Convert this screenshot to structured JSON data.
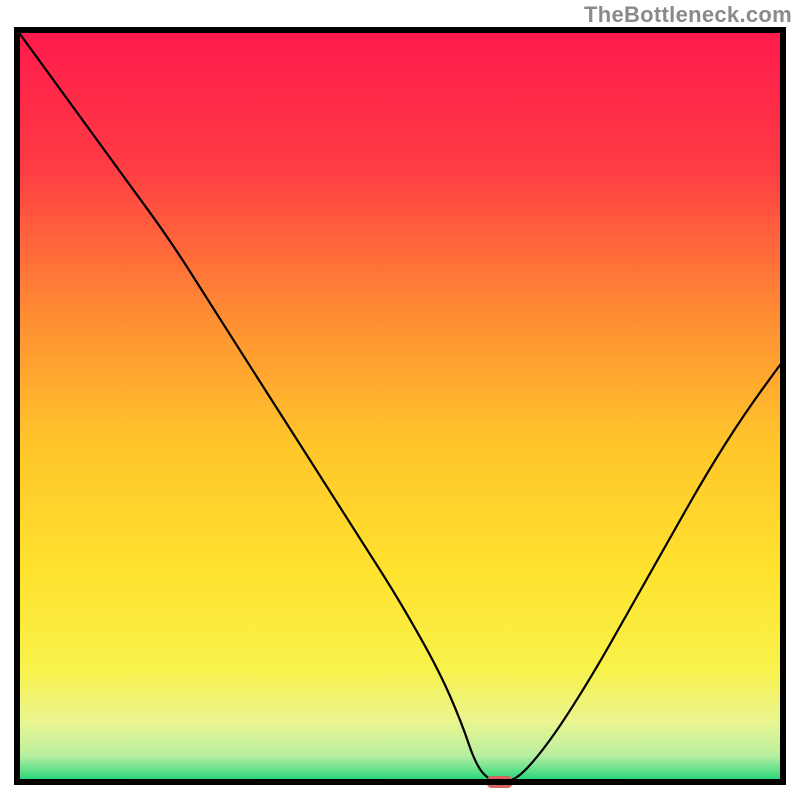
{
  "watermark": "TheBottleneck.com",
  "chart_data": {
    "type": "line",
    "title": "",
    "xlabel": "",
    "ylabel": "",
    "xlim": [
      0,
      100
    ],
    "ylim": [
      0,
      100
    ],
    "x": [
      0,
      5,
      10,
      15,
      20,
      25,
      30,
      35,
      40,
      45,
      50,
      55,
      58,
      60,
      62,
      64,
      66,
      70,
      75,
      80,
      85,
      90,
      95,
      100
    ],
    "values": [
      100,
      93,
      86,
      79,
      72,
      64,
      56,
      48,
      40,
      32,
      24,
      15,
      8,
      2,
      0,
      0,
      1,
      6,
      14,
      23,
      32,
      41,
      49,
      56
    ],
    "minimum_marker": {
      "x": 63,
      "y": 0
    },
    "gradient_stops": [
      {
        "offset": 0.0,
        "color": "#ff1a4d"
      },
      {
        "offset": 0.18,
        "color": "#ff3b44"
      },
      {
        "offset": 0.38,
        "color": "#ff8d33"
      },
      {
        "offset": 0.55,
        "color": "#ffc52a"
      },
      {
        "offset": 0.72,
        "color": "#ffe22e"
      },
      {
        "offset": 0.85,
        "color": "#f8f24b"
      },
      {
        "offset": 0.92,
        "color": "#eaf590"
      },
      {
        "offset": 0.965,
        "color": "#b8efa0"
      },
      {
        "offset": 0.985,
        "color": "#5fe08a"
      },
      {
        "offset": 1.0,
        "color": "#17d37a"
      }
    ],
    "marker_color": "#d7655f",
    "frame_color": "#000000"
  }
}
